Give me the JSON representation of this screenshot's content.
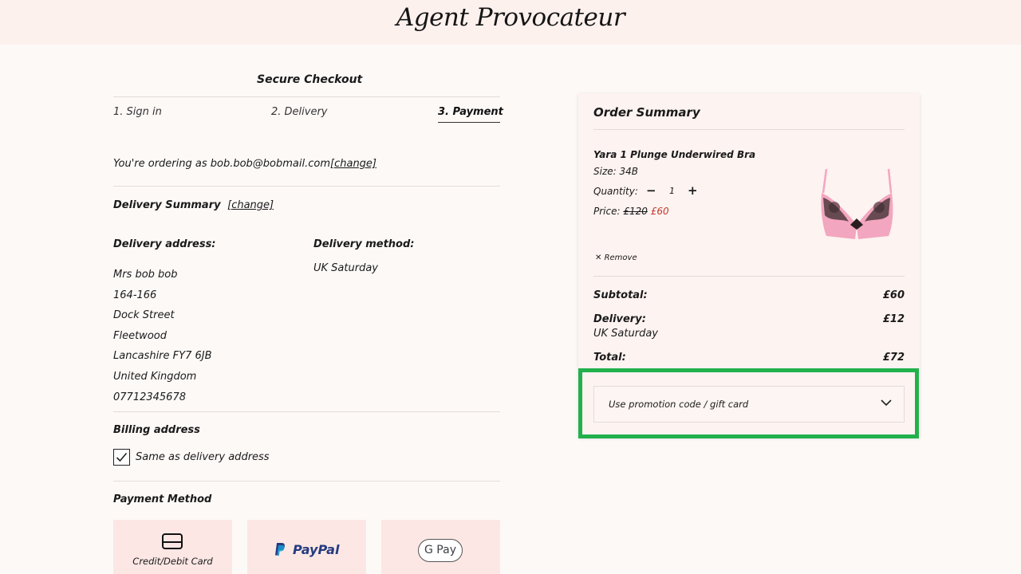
{
  "brand": {
    "logo_text": "Agent Provocateur"
  },
  "checkout": {
    "title": "Secure Checkout",
    "steps": [
      {
        "label": "1.  Sign in"
      },
      {
        "label": "2.  Delivery"
      },
      {
        "label": "3.  Payment"
      }
    ],
    "ordering_as_prefix": "You're ordering as bob.bob@bobmail.com",
    "change_label": "[change]",
    "delivery_summary_title": "Delivery Summary",
    "delivery_address_label": "Delivery address:",
    "delivery_method_label": "Delivery method:",
    "delivery_method_value": "UK Saturday",
    "address_lines": [
      "Mrs bob bob",
      "164-166",
      "Dock Street",
      "Fleetwood",
      "Lancashire FY7 6JB",
      "United Kingdom",
      "07712345678"
    ],
    "billing_title": "Billing address",
    "same_as_delivery_label": "Same as delivery address",
    "payment_method_title": "Payment Method",
    "payment_options": [
      {
        "label": "Credit/Debit Card",
        "icon": "card-icon"
      },
      {
        "label": "PayPal",
        "icon": "paypal-logo"
      },
      {
        "label": "G Pay",
        "icon": "google-pay-logo"
      }
    ]
  },
  "order_summary": {
    "title": "Order Summary",
    "item": {
      "name": "Yara 1 Plunge Underwired Bra",
      "size_label": "Size: 34B",
      "quantity_label": "Quantity:",
      "quantity_value": "1",
      "price_label": "Price:",
      "price_old": "£120",
      "price_new": "£60",
      "remove_label": "Remove",
      "product_colors": {
        "pink": "#f3a6bf",
        "lace": "#3a2b2e"
      }
    },
    "subtotal_label": "Subtotal:",
    "subtotal_value": "£60",
    "delivery_label": "Delivery:",
    "delivery_method": "UK Saturday",
    "delivery_value": "£12",
    "total_label": "Total:",
    "total_value": "£72",
    "promo_label": "Use promotion code / gift card"
  },
  "colors": {
    "highlight": "#22b14c",
    "sale_price": "#c0392b",
    "paypal_dark": "#253b80",
    "paypal_light": "#179bd7"
  }
}
